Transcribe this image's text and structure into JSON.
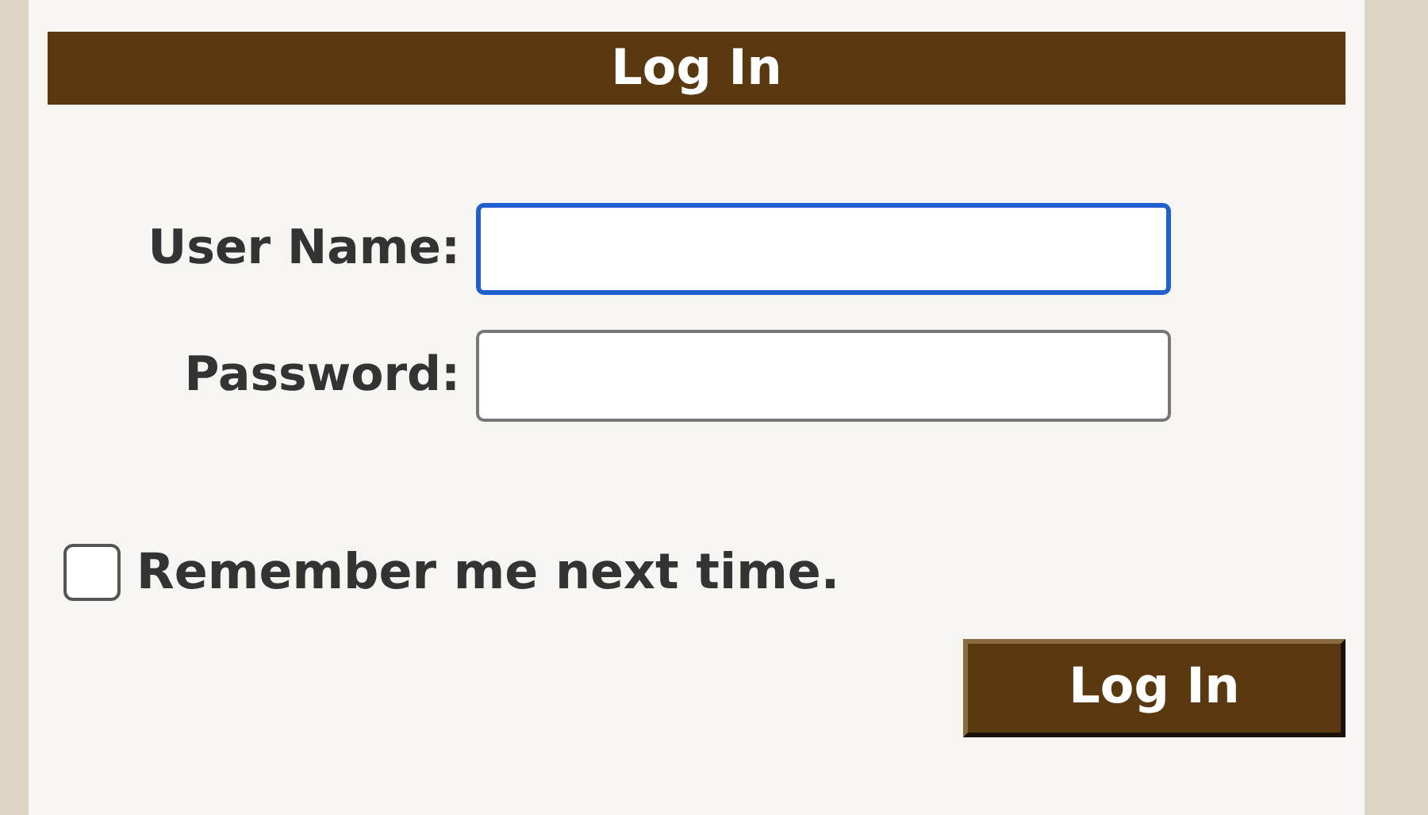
{
  "title": "Log In",
  "fields": [
    {
      "label": "User Name:",
      "focused": true
    },
    {
      "label": "Password:",
      "focused": false
    }
  ],
  "remember": {
    "label": "Remember me next time.",
    "checked": false
  },
  "button": "Log In"
}
